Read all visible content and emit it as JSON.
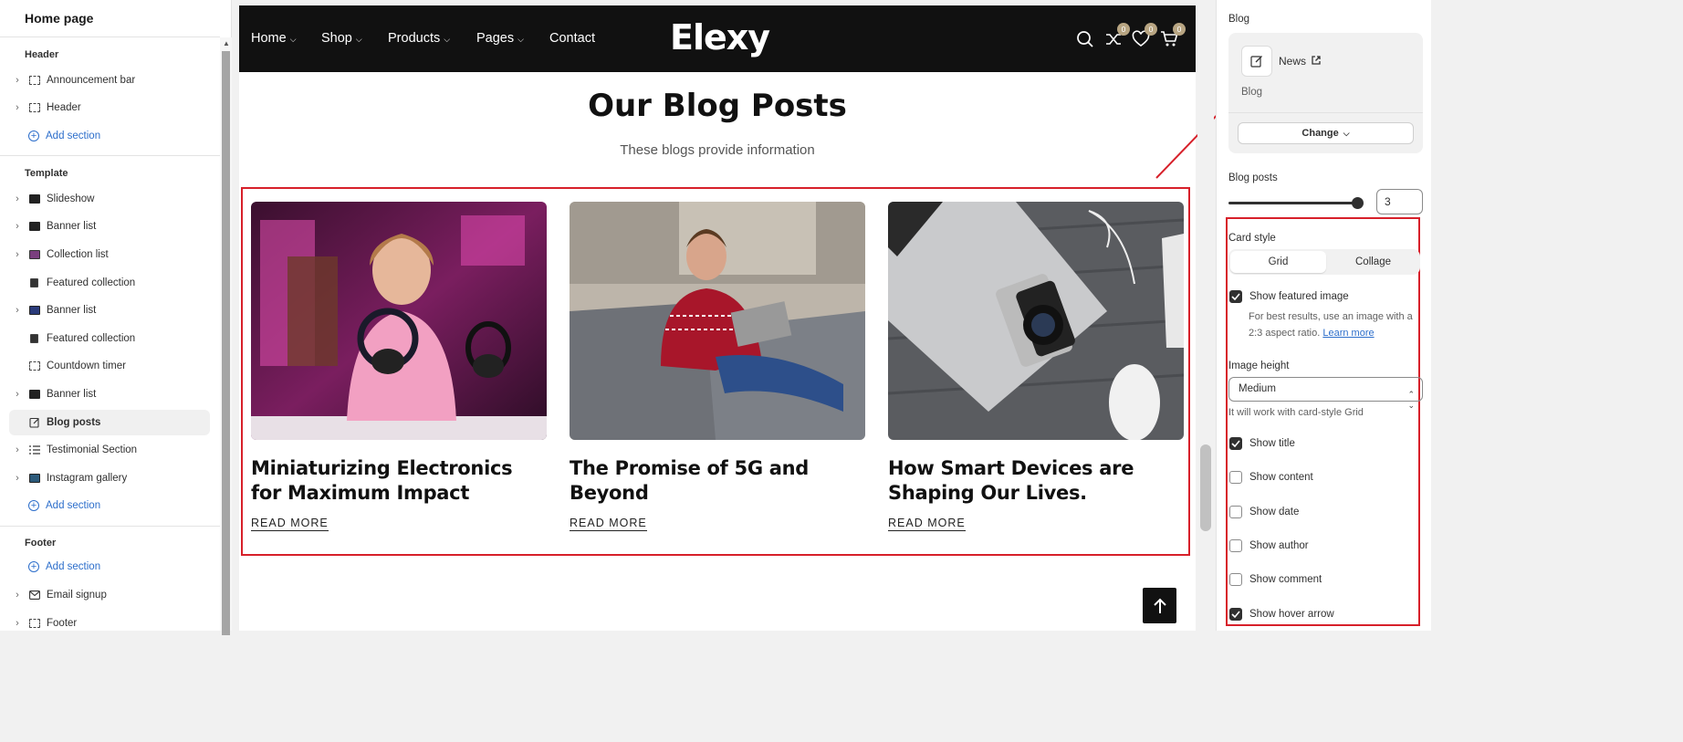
{
  "sidebar": {
    "title": "Home page",
    "header_group": "Header",
    "header_items": [
      "Announcement bar",
      "Header"
    ],
    "add_section": "Add section",
    "template_group": "Template",
    "template_items": [
      "Slideshow",
      "Banner list",
      "Collection list",
      "Featured collection",
      "Banner list",
      "Featured collection",
      "Countdown timer",
      "Banner list",
      "Blog posts",
      "Testimonial Section",
      "Instagram gallery"
    ],
    "footer_group": "Footer",
    "footer_items": [
      "Email signup",
      "Footer"
    ]
  },
  "store": {
    "nav": [
      "Home",
      "Shop",
      "Products",
      "Pages",
      "Contact"
    ],
    "logo": "Elexy",
    "counts": {
      "compare": "0",
      "wishlist": "0",
      "cart": "0"
    },
    "section_title": "Our Blog Posts",
    "section_subtitle": "These blogs provide information",
    "posts": [
      {
        "title": "Miniaturizing Electronics for Maximum Impact",
        "link": "READ MORE"
      },
      {
        "title": "The Promise of 5G and Beyond",
        "link": "READ MORE"
      },
      {
        "title": "How Smart Devices are Shaping Our Lives.",
        "link": "READ MORE"
      }
    ]
  },
  "settings": {
    "blog_label": "Blog",
    "blog_name": "News",
    "blog_sub": "Blog",
    "change": "Change",
    "posts_label": "Blog posts",
    "posts_value": "3",
    "posts_level": 1.0,
    "card_style_label": "Card style",
    "card_styles": [
      "Grid",
      "Collage"
    ],
    "show_featured_image": "Show featured image",
    "help_text": "For best results, use an image with a 2:3 aspect ratio.",
    "learn_more": "Learn more",
    "image_height_label": "Image height",
    "image_height_value": "Medium",
    "image_height_help": "It will work with card-style Grid",
    "toggles": [
      {
        "label": "Show title",
        "checked": true
      },
      {
        "label": "Show content",
        "checked": false
      },
      {
        "label": "Show date",
        "checked": false
      },
      {
        "label": "Show author",
        "checked": false
      },
      {
        "label": "Show comment",
        "checked": false
      },
      {
        "label": "Show hover arrow",
        "checked": true
      }
    ]
  },
  "colors": {
    "accent_red": "#d7202a",
    "link_blue": "#2c6ecb",
    "badge": "#b8a582",
    "nav_bg": "#111111"
  }
}
